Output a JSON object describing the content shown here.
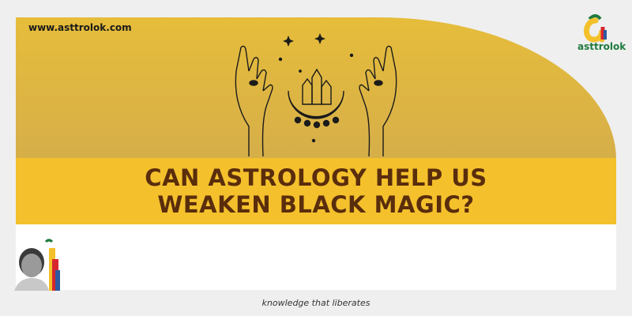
{
  "header": {
    "website": "www.asttrolok.com"
  },
  "brand": {
    "name": "asttrolok",
    "icon": "asttrolok-logo-icon",
    "colors": {
      "green": "#1f7a3d",
      "red": "#d7262e",
      "yellow": "#f4c12c",
      "blue": "#2c5aa0"
    }
  },
  "hero": {
    "illustration": "hands-crystal-moon-illustration",
    "headline_line1": "CAN ASTROLOGY HELP US",
    "headline_line2": "WEAKEN BLACK MAGIC?",
    "colors": {
      "gold": "#d8b048",
      "banner": "#f4c12c",
      "headline": "#5a2d0c"
    }
  },
  "footer": {
    "tagline": "knowledge that liberates",
    "avatar": "presenter-avatar"
  }
}
